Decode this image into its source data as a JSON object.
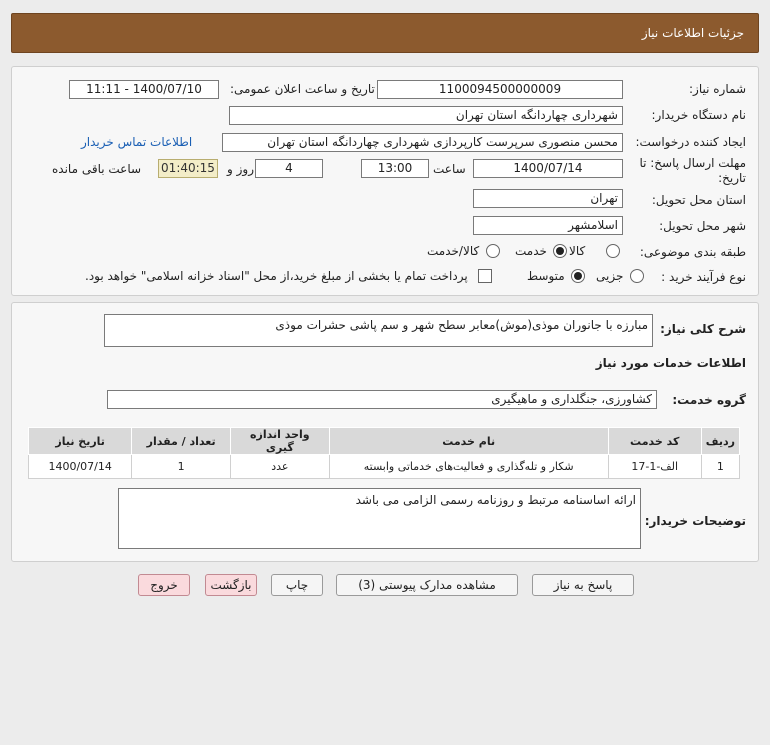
{
  "header": {
    "title": "جزئیات اطلاعات نیاز"
  },
  "info": {
    "need_number_label": "شماره نیاز:",
    "need_number": "1100094500000009",
    "announce_label": "تاریخ و ساعت اعلان عمومی:",
    "announce_value": "1400/07/10 - 11:11",
    "buyer_label": "نام دستگاه خریدار:",
    "buyer_value": "شهرداری چهاردانگه استان تهران",
    "creator_label": "ایجاد کننده درخواست:",
    "creator_value": "محسن منصوری سرپرست کارپردازی شهرداری چهاردانگه استان تهران",
    "contact_link": "اطلاعات تماس خریدار",
    "deadline_label_line1": "مهلت ارسال پاسخ: تا",
    "deadline_label_line2": "تاریخ:",
    "deadline_date": "1400/07/14",
    "time_label": "ساعت",
    "deadline_time": "13:00",
    "days_value": "4",
    "days_label": "روز و",
    "remaining_time": "01:40:15",
    "remaining_label": "ساعت باقی مانده",
    "province_label": "استان محل تحویل:",
    "province_value": "تهران",
    "city_label": "شهر محل تحویل:",
    "city_value": "اسلامشهر",
    "category_label": "طبقه بندی موضوعی:",
    "category_options": [
      "کالا",
      "خدمت",
      "کالا/خدمت"
    ],
    "category_selected": "خدمت",
    "process_label": "نوع فرآیند خرید :",
    "process_options": [
      "جزیی",
      "متوسط"
    ],
    "process_selected": "متوسط",
    "payment_note": "پرداخت تمام یا بخشی از مبلغ خرید،از محل \"اسناد خزانه اسلامی\" خواهد بود."
  },
  "details": {
    "summary_label": "شرح کلی نیاز:",
    "summary_value": "مبارزه با جانوران موذی(موش)معابر سطح شهر و سم پاشی حشرات موذی",
    "services_heading": "اطلاعات خدمات مورد نیاز",
    "service_group_label": "گروه خدمت:",
    "service_group_value": "کشاورزی، جنگلداری و ماهیگیری",
    "table": {
      "headers": [
        "ردیف",
        "کد خدمت",
        "نام خدمت",
        "واحد اندازه گیری",
        "تعداد / مقدار",
        "تاریخ نیاز"
      ],
      "rows": [
        [
          "1",
          "الف-1-17",
          "شکار و تله‌گذاری و فعالیت‌های خدماتی وابسته",
          "عدد",
          "1",
          "1400/07/14"
        ]
      ]
    },
    "buyer_notes_label": "توضیحات خریدار:",
    "buyer_notes_value": "ارائه اساسنامه مرتبط و روزنامه رسمی الزامی می باشد"
  },
  "buttons": {
    "reply": "پاسخ به نیاز",
    "attachments": "مشاهده مدارک پیوستی (3)",
    "print": "چاپ",
    "back": "بازگشت",
    "exit": "خروج"
  },
  "colors": {
    "header_bg": "#8c5a2e",
    "link": "#1a5fb4",
    "remaining_bg": "#f3edc8",
    "pink_button": "#fadadd"
  }
}
